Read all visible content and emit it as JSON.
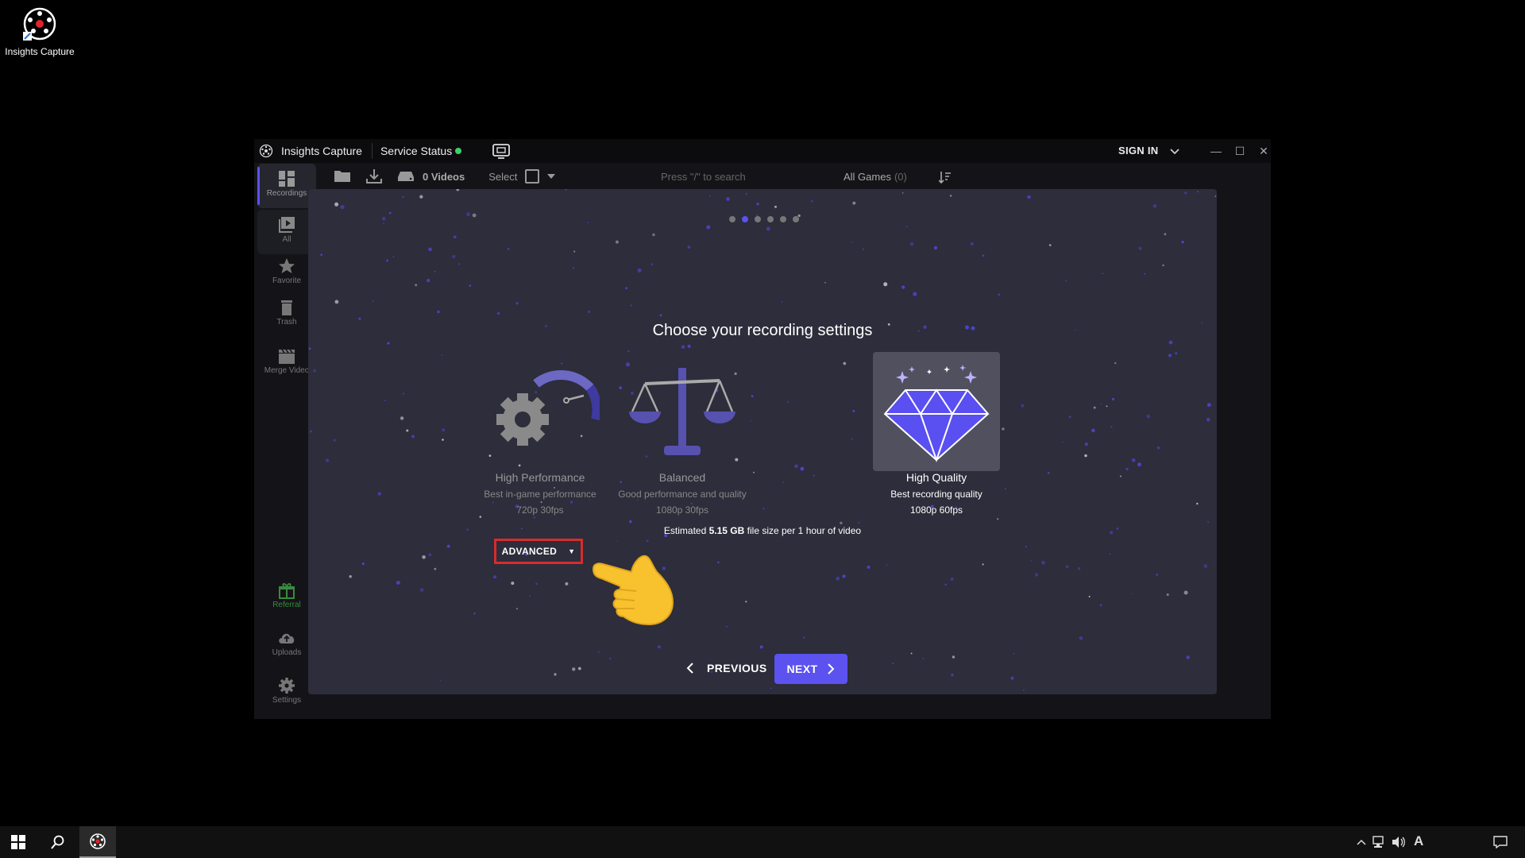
{
  "desktop": {
    "icon_label": "Insights Capture"
  },
  "window": {
    "title": "Insights Capture",
    "service_status": "Service Status",
    "service_status_color": "#3fcf6a",
    "sign_in": "SIGN IN"
  },
  "sidebar": {
    "items": [
      {
        "label": "Recordings",
        "icon": "grid-icon",
        "active": true
      },
      {
        "label": "All",
        "icon": "play-icon"
      },
      {
        "label": "Favorite",
        "icon": "star-icon"
      },
      {
        "label": "Trash",
        "icon": "trash-icon"
      },
      {
        "label": "Merge Video",
        "icon": "clapper-icon"
      },
      {
        "label": "Referral",
        "icon": "gift-icon"
      },
      {
        "label": "Uploads",
        "icon": "cloud-upload-icon"
      },
      {
        "label": "Settings",
        "icon": "gear-icon"
      }
    ]
  },
  "toolbar": {
    "videos": "0 Videos",
    "select": "Select",
    "search_placeholder": "Press \"/\" to search",
    "all_games": "All Games",
    "all_games_count": "(0)"
  },
  "dialog": {
    "heading": "Choose your recording settings",
    "step": {
      "current": 2,
      "total": 6
    },
    "options": [
      {
        "title": "High Performance",
        "subtitle": "Best in-game performance",
        "format": "720p 30fps",
        "icon": "gear-speedometer-icon"
      },
      {
        "title": "Balanced",
        "subtitle": "Good performance and quality",
        "format": "1080p 30fps",
        "icon": "scale-icon"
      },
      {
        "title": "High Quality",
        "subtitle": "Best recording quality",
        "format": "1080p 60fps",
        "icon": "diamond-icon",
        "selected": true
      }
    ],
    "estimate_prefix": "Estimated",
    "estimate_value": "5.15 GB",
    "estimate_suffix": "file size per 1 hour of video",
    "advanced": "ADVANCED",
    "previous": "PREVIOUS",
    "next": "NEXT"
  },
  "colors": {
    "accent": "#5b52f0",
    "highlight_box": "#d92b2b",
    "panel": "#2d2d3b"
  }
}
